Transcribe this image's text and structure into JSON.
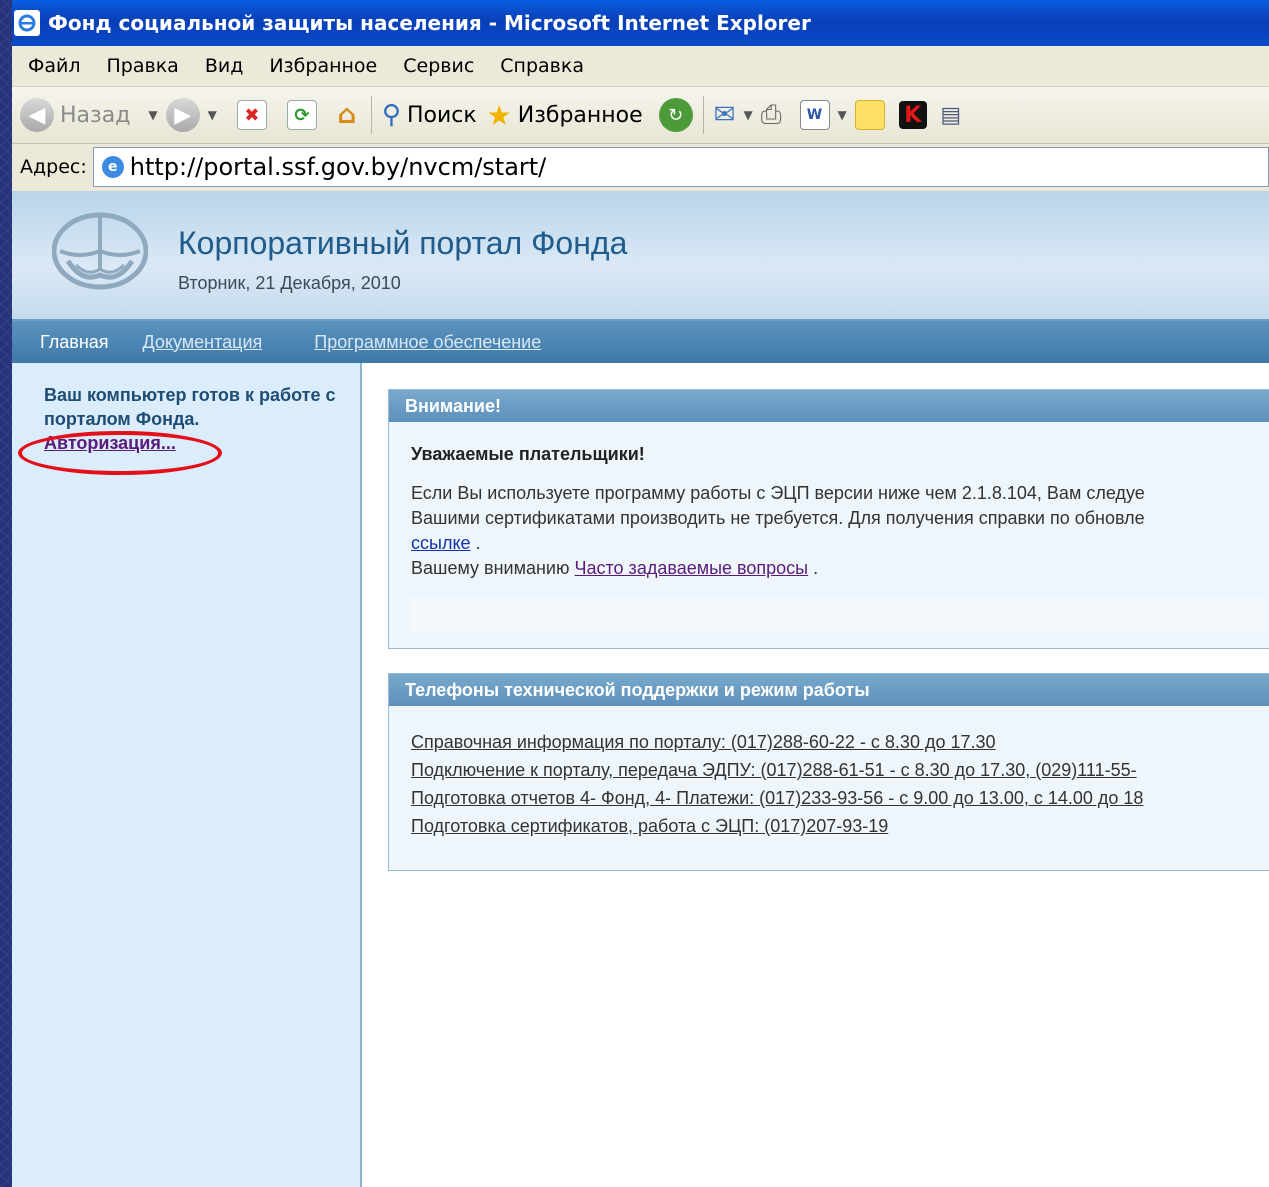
{
  "window": {
    "title": "Фонд социальной защиты населения - Microsoft Internet Explorer"
  },
  "menu": [
    "Файл",
    "Правка",
    "Вид",
    "Избранное",
    "Сервис",
    "Справка"
  ],
  "toolbar": {
    "back_label": "Назад",
    "search_label": "Поиск",
    "favorites_label": "Избранное"
  },
  "address": {
    "label": "Адрес:",
    "url": "http://portal.ssf.gov.by/nvcm/start/"
  },
  "portal": {
    "title": "Корпоративный портал Фонда",
    "date": "Вторник, 21 Декабря, 2010"
  },
  "nav": {
    "home": "Главная",
    "docs": "Документация",
    "software": "Программное обеспечение"
  },
  "sidebar": {
    "ready_text": "Ваш компьютер готов к работе с порталом Фонда.",
    "login_link": "Авторизация..."
  },
  "attention": {
    "header": "Внимание!",
    "greeting": "Уважаемые плательщики!",
    "line1": "Если Вы используете программу работы с ЭЦП версии ниже чем 2.1.8.104, Вам следуе",
    "line2": "Вашими сертификатами производить не требуется. Для получения справки по обновле",
    "link_text": "ссылке",
    "line3_prefix": "Вашему вниманию",
    "faq_link": "Часто задаваемые вопросы"
  },
  "support": {
    "header": "Телефоны технической поддержки и режим работы",
    "lines": [
      "Справочная информация по порталу: (017)288-60-22 - с 8.30 до 17.30",
      "Подключение к порталу, передача ЭДПУ: (017)288-61-51 - с 8.30 до 17.30, (029)111-55-",
      "Подготовка отчетов 4- Фонд, 4- Платежи: (017)233-93-56 - с 9.00 до 13.00, с 14.00 до 18",
      "Подготовка сертификатов, работа с ЭЦП: (017)207-93-19"
    ]
  }
}
